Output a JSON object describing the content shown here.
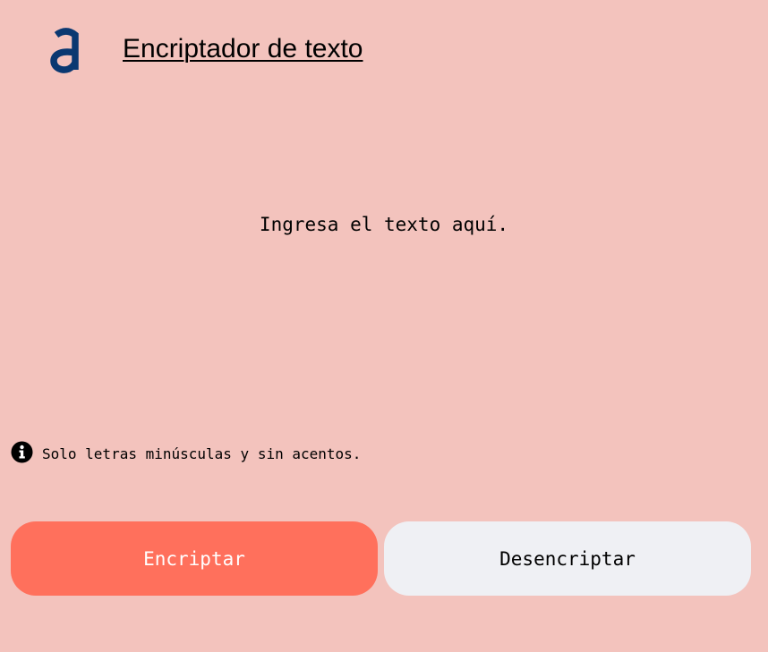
{
  "header": {
    "logo_icon": "alura-a-logo-icon",
    "logo_color": "#0a3871",
    "title": "Encriptador de texto"
  },
  "input": {
    "placeholder": "Ingresa el texto aquí.",
    "value": ""
  },
  "info": {
    "icon": "info-circle-icon",
    "text": "Solo letras minúsculas y sin acentos."
  },
  "buttons": {
    "encrypt_label": "Encriptar",
    "decrypt_label": "Desencriptar",
    "encrypt_color": "#ff705c",
    "decrypt_color": "#eff0f4"
  },
  "colors": {
    "background": "#f3c3bd"
  }
}
